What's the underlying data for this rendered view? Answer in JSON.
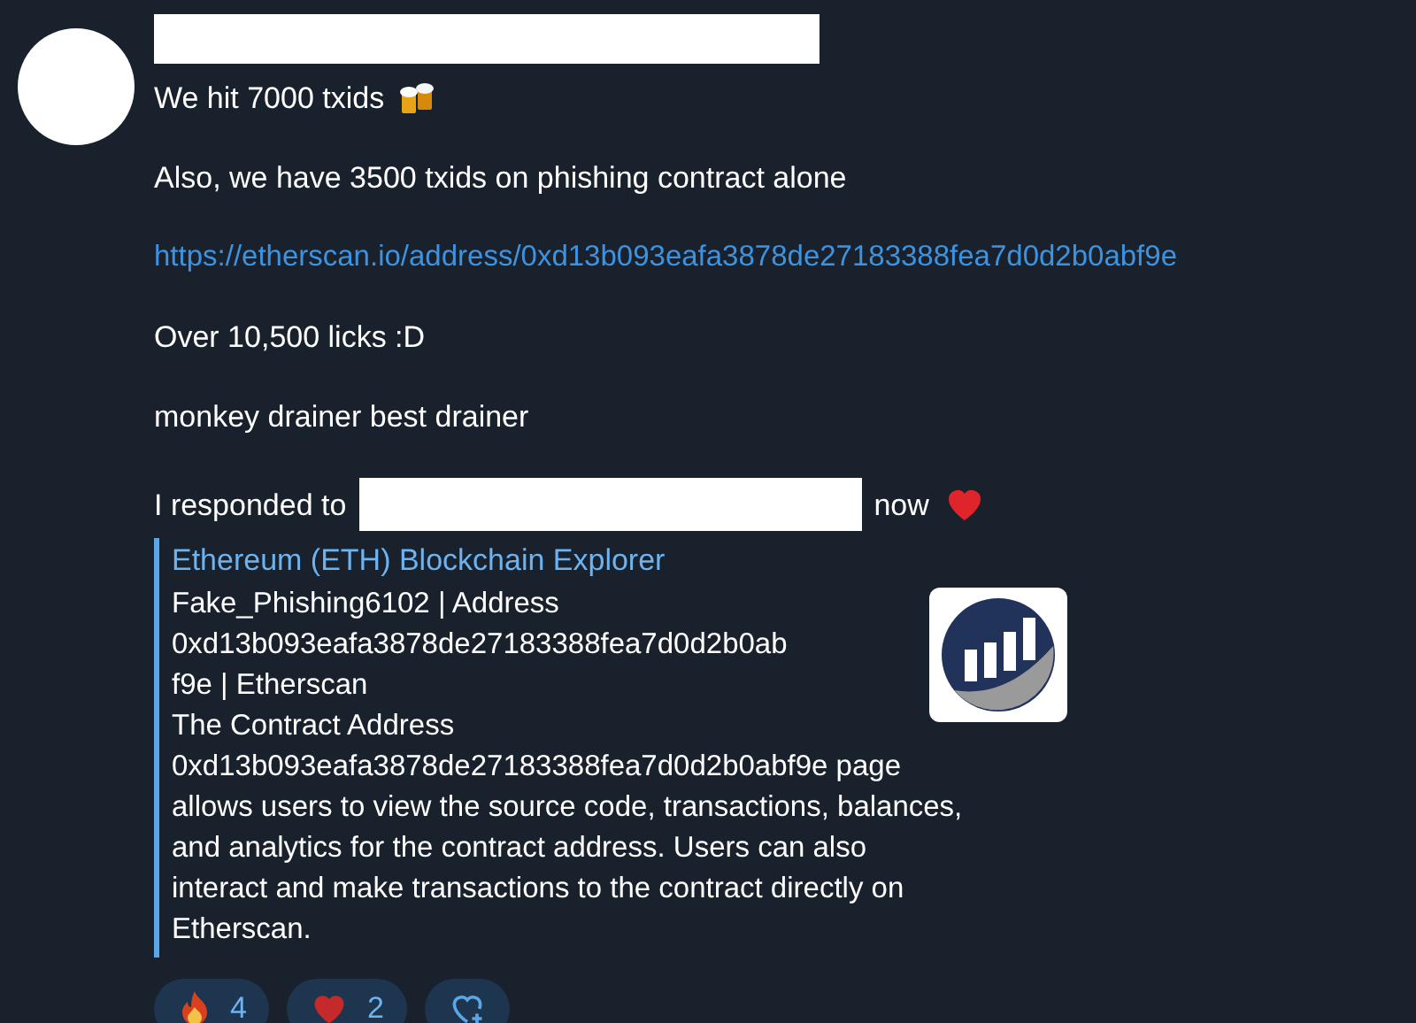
{
  "message": {
    "sender_redacted": true,
    "lines": [
      {
        "kind": "beer",
        "text": "We hit 7000 txids"
      },
      {
        "kind": "text",
        "text": "Also, we have 3500 txids on phishing contract alone"
      },
      {
        "kind": "link",
        "text": "https://etherscan.io/address/0xd13b093eafa3878de27183388fea7d0d2b0abf9e"
      },
      {
        "kind": "text",
        "text": "Over 10,500 licks :D"
      },
      {
        "kind": "text",
        "text": "monkey drainer best drainer"
      },
      {
        "kind": "redacted",
        "text": "I responded to",
        "after": "now"
      }
    ],
    "preview": {
      "site": "Ethereum (ETH) Blockchain Explorer",
      "title_lines": [
        "Fake_Phishing6102 | Address",
        "0xd13b093eafa3878de27183388fea7d0d2b0ab",
        "f9e | Etherscan"
      ],
      "description_lines": [
        "The Contract Address",
        "0xd13b093eafa3878de27183388fea7d0d2b0abf9e page",
        "allows users to view the source code, transactions, balances,",
        "and analytics for the contract address. Users can also",
        "interact and make transactions to the contract directly on",
        "Etherscan."
      ]
    },
    "reactions": [
      {
        "kind": "fire",
        "count": "4"
      },
      {
        "kind": "heart",
        "count": "2"
      },
      {
        "kind": "add"
      }
    ]
  }
}
